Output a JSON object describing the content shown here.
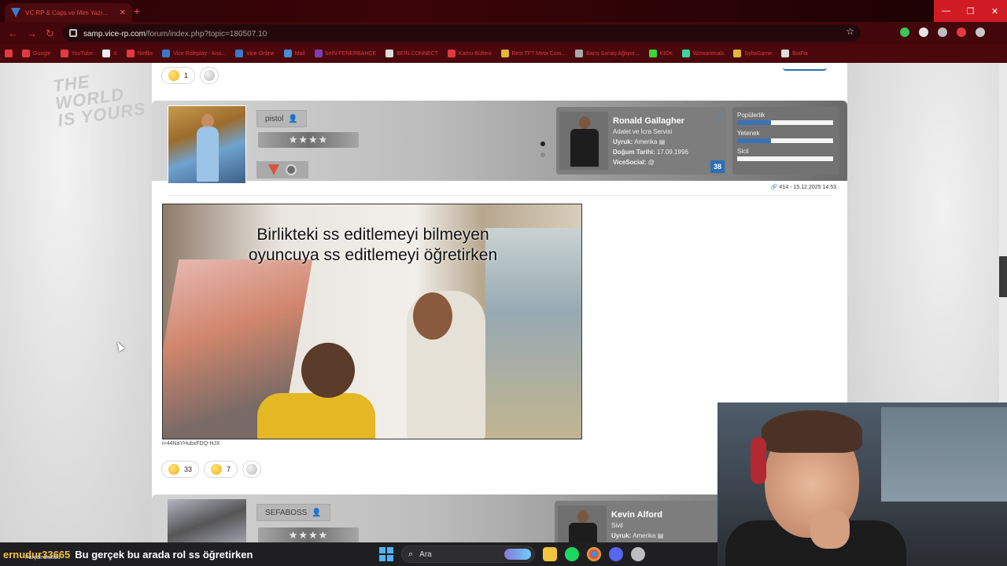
{
  "browser": {
    "tab_title": "VC:RP & Caps ve Mim Yazı...",
    "url_host": "samp.vice-rp.com",
    "url_path": "/forum/index.php?topic=180507.10",
    "bookmarks": [
      {
        "label": "Google",
        "color": "#e23a40"
      },
      {
        "label": "YouTube",
        "color": "#e23a40"
      },
      {
        "label": "X",
        "color": "#eeeeee"
      },
      {
        "label": "Netflix",
        "color": "#e23a40"
      },
      {
        "label": "Vice Roleplay - Ana...",
        "color": "#3a78c9"
      },
      {
        "label": "Vice Online",
        "color": "#3a78c9"
      },
      {
        "label": "Mail",
        "color": "#4a8ad6"
      },
      {
        "label": "beIN FENERBAHÇE",
        "color": "#7b3fb3"
      },
      {
        "label": "BEIN CONNECT",
        "color": "#dddddd"
      },
      {
        "label": "Kamu Bülteni",
        "color": "#e23a40"
      },
      {
        "label": "Best TFT Meta Com...",
        "color": "#e2b63a"
      },
      {
        "label": "Barış Sarıaş Ağlıyor...",
        "color": "#aaaaaa"
      },
      {
        "label": "KICK",
        "color": "#3ad63a"
      },
      {
        "label": "Wowanimals",
        "color": "#3ad6a0"
      },
      {
        "label": "SyltaGame",
        "color": "#e2b63a"
      },
      {
        "label": "BotFix",
        "color": "#dddddd"
      }
    ]
  },
  "page": {
    "top_reactions": [
      {
        "emoji": "laughing",
        "count": "1"
      },
      {
        "emoji": "add",
        "count": ""
      }
    ],
    "post": {
      "username": "pistol",
      "stars": "★★★★",
      "character": {
        "name": "Ronald Gallagher",
        "role": "Adalet ve İcra Servisi",
        "nationality_label": "Uyruk:",
        "nationality_value": "Amerika",
        "birth_label": "Doğum Tarihi:",
        "birth_value": "17.09.1996",
        "social_label": "ViceSocial:",
        "social_value": "@",
        "level": "38"
      },
      "stats": [
        {
          "label": "Popülerlik",
          "fill": 0.35
        },
        {
          "label": "Yetenek",
          "fill": 0.35
        },
        {
          "label": "Sicil",
          "fill": 0.0
        }
      ],
      "meta": "#14 - 15.12.2025 14:53",
      "media_caption_line1": "Birlikteki ss editlemeyi bilmeyen",
      "media_caption_line2": "oyuncuya ss editlemeyi öğretirken",
      "video_id": "i=44NaYHubxFDQ-HJX",
      "reactions": [
        {
          "emoji": "laughing-hard",
          "count": "33"
        },
        {
          "emoji": "laughing",
          "count": "7"
        },
        {
          "emoji": "add",
          "count": ""
        }
      ]
    },
    "post2": {
      "username": "SEFABOSS",
      "stars": "★★★★",
      "character": {
        "name": "Kevin Alford",
        "role": "Sivil",
        "nationality_label": "Uyruk:",
        "nationality_value": "Amerika"
      }
    }
  },
  "stream": {
    "chat_user": "ernudur33665",
    "chat_sub": "Parçalı bulutlu",
    "chat_message": "Bu gerçek bu arada rol ss öğretirken",
    "search_label": "Ara"
  }
}
